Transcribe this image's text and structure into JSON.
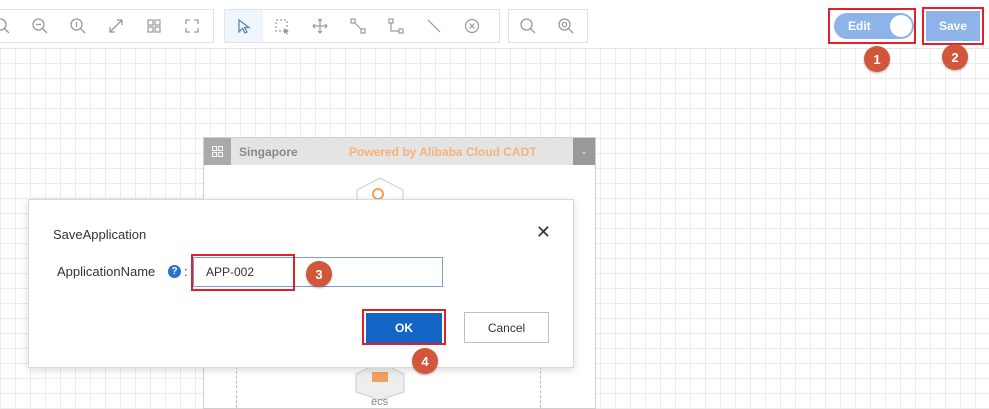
{
  "toolbar": {
    "edit_label": "Edit",
    "save_label": "Save"
  },
  "canvas": {
    "region_name": "Singapore",
    "powered_text": "Powered by Alibaba Cloud CADT",
    "collapse_symbol": "-",
    "node_label": "ecs"
  },
  "dialog": {
    "title": "SaveApplication",
    "field_label": "ApplicationName",
    "field_value": "APP-002",
    "ok_label": "OK",
    "cancel_label": "Cancel"
  },
  "markers": {
    "m1": "1",
    "m2": "2",
    "m3": "3",
    "m4": "4"
  },
  "colors": {
    "accent": "#1466c6",
    "toggle": "#8db3e8",
    "highlight": "#e0202a",
    "marker": "#d2573a"
  }
}
